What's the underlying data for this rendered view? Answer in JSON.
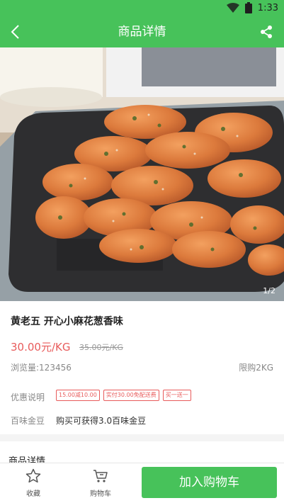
{
  "status": {
    "time": "1:33"
  },
  "header": {
    "title": "商品详情"
  },
  "gallery": {
    "counter": "1/2"
  },
  "product": {
    "name": "黄老五 开心小麻花葱香味",
    "price": "30.00元/KG",
    "original_price": "35.00元/KG",
    "views": "浏览量:123456",
    "limit": "限购2KG",
    "promo_label": "优惠说明",
    "promo_tags": [
      "15.00减10.00",
      "实付30.00免配送费",
      "买一送一"
    ],
    "beans_label": "百味金豆",
    "beans_value": "购买可获得3.0百味金豆"
  },
  "detail": {
    "section_title": "商品详情"
  },
  "bottom": {
    "favorite_label": "收藏",
    "cart_label": "购物车",
    "add_to_cart": "加入购物车"
  },
  "colors": {
    "brand_green": "#47c25a",
    "price_red": "#e85b5b"
  }
}
